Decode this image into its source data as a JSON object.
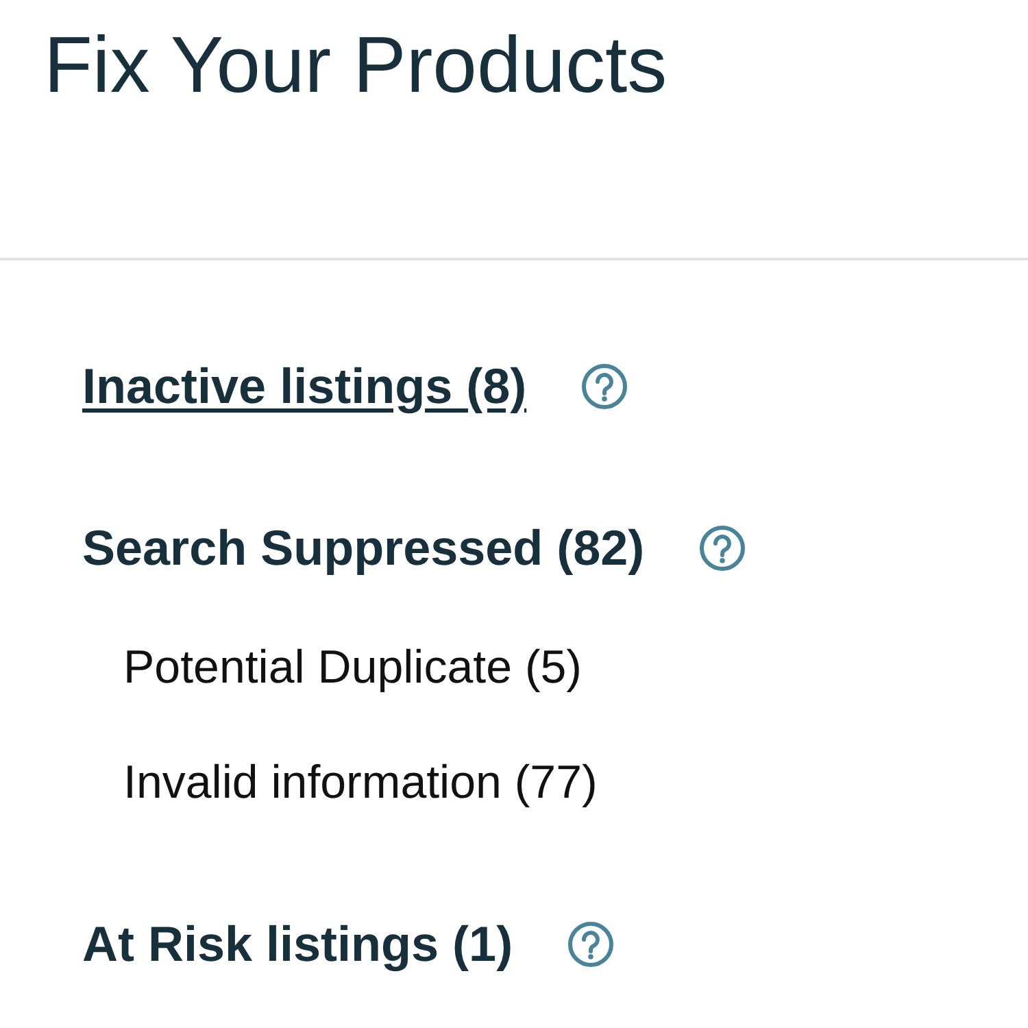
{
  "title": "Fix Your Products",
  "sections": [
    {
      "kind": "link",
      "label": "Inactive listings (8)",
      "help": true
    },
    {
      "kind": "heading",
      "label": "Search Suppressed (82)",
      "help": true,
      "children": [
        {
          "label": "Potential Duplicate (5)"
        },
        {
          "label": "Invalid information (77)"
        }
      ]
    },
    {
      "kind": "heading",
      "label": "At Risk listings (1)",
      "help": true
    }
  ]
}
